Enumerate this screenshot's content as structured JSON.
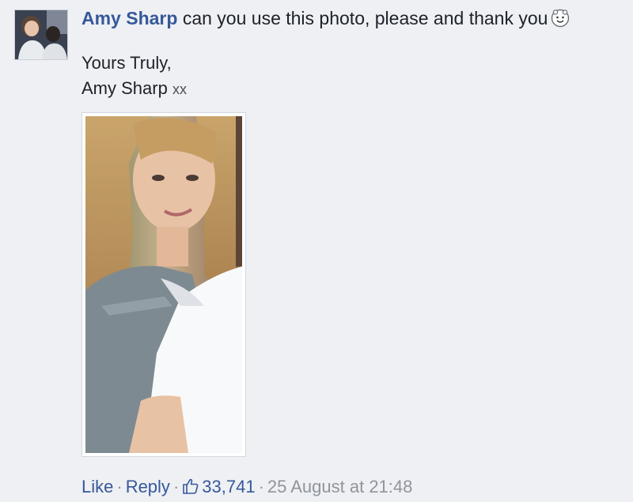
{
  "comment": {
    "author": "Amy Sharp",
    "text": "can you use this photo, please and thank you",
    "emoji_icon": "smiley-face-icon",
    "signoff_line1": "Yours Truly,",
    "signoff_name": "Amy Sharp",
    "signoff_suffix": "xx"
  },
  "actions": {
    "like_label": "Like",
    "reply_label": "Reply",
    "separator": "·",
    "like_count": "33,741",
    "timestamp": "25 August at 21:48",
    "thumb_icon": "thumbs-up-icon"
  },
  "colors": {
    "link": "#365899",
    "background": "#eef0f4",
    "meta": "#90949c"
  }
}
